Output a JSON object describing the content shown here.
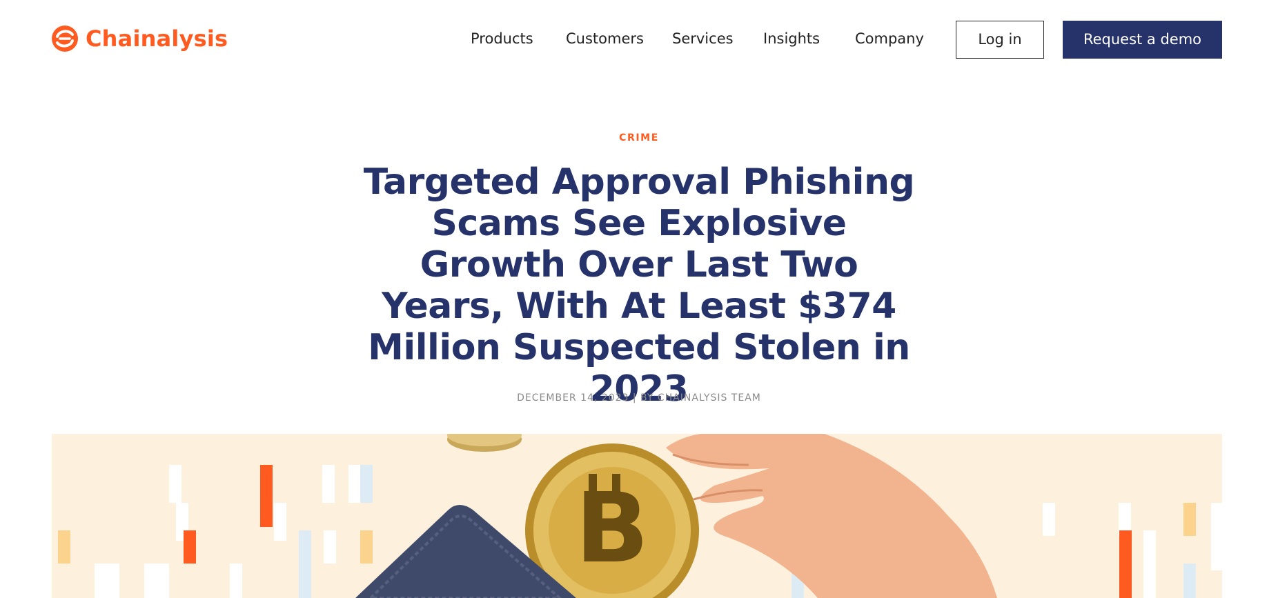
{
  "brand": {
    "name": "Chainalysis",
    "color": "#ff5a1f"
  },
  "nav": {
    "items": [
      {
        "label": "Products"
      },
      {
        "label": "Customers"
      },
      {
        "label": "Services"
      },
      {
        "label": "Insights"
      },
      {
        "label": "Company"
      }
    ],
    "login_label": "Log in",
    "demo_label": "Request a demo",
    "demo_color": "#26336a"
  },
  "article": {
    "category": "CRIME",
    "title": "Targeted Approval Phishing Scams See Explosive Growth Over Last Two Years, With At Least $374 Million Suspected Stolen in 2023",
    "meta": "DECEMBER 14, 2023 | BY CHAINALYSIS TEAM",
    "title_color": "#26336a"
  },
  "hero": {
    "icons": [
      "coin-icon",
      "bitcoin-icon",
      "wallet-icon",
      "hand-icon"
    ]
  }
}
